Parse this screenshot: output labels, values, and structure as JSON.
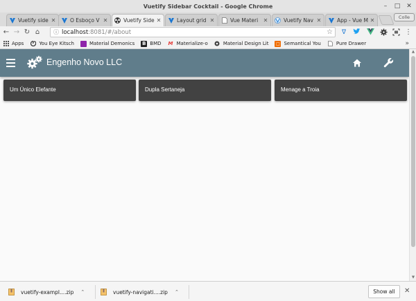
{
  "window": {
    "title": "Vuetify Sidebar Cocktail - Google Chrome"
  },
  "tabs": [
    {
      "label": "Vuetify side",
      "icon": "vuetify-icon",
      "active": false
    },
    {
      "label": "O Esboço V",
      "icon": "vuetify-icon",
      "active": false
    },
    {
      "label": "Vuetify Side",
      "icon": "radiation-icon",
      "active": true
    },
    {
      "label": "Layout grid",
      "icon": "vuetify-icon",
      "active": false
    },
    {
      "label": "Vue Materi",
      "icon": "page-icon",
      "active": false
    },
    {
      "label": "Vuetify Nav",
      "icon": "vue-icon",
      "active": false
    },
    {
      "label": "App - Vue M",
      "icon": "vuetify-icon",
      "active": false
    }
  ],
  "profile": {
    "label": "Colle"
  },
  "address_bar": {
    "host": "localhost",
    "path": ":8081/#/about"
  },
  "bookmarks": [
    {
      "label": "Apps",
      "icon": "apps-grid-icon",
      "color": "#555555"
    },
    {
      "label": "You Eye Kitsch",
      "icon": "swirl-icon",
      "color": "#333333"
    },
    {
      "label": "Material Demonics",
      "icon": "purple-square-icon",
      "color": "#8e24aa"
    },
    {
      "label": "BMD",
      "icon": "b-icon",
      "color": "#222222"
    },
    {
      "label": "Materialize-o",
      "icon": "m-icon",
      "color": "#e53935"
    },
    {
      "label": "Material Design Lit",
      "icon": "circle-icon",
      "color": "#424242"
    },
    {
      "label": "Semantical You",
      "icon": "orange-square-icon",
      "color": "#ef6c00"
    },
    {
      "label": "Pure Drawer",
      "icon": "page-icon",
      "color": "#777777"
    }
  ],
  "app": {
    "title": "Engenho Novo LLC",
    "appbar_color": "#607d8b",
    "card_color": "#424242",
    "cards": [
      {
        "label": "Um Único Elefante"
      },
      {
        "label": "Dupla Sertaneja"
      },
      {
        "label": "Menage a Troia"
      }
    ]
  },
  "downloads": [
    {
      "name": "vuetify-exampl....zip"
    },
    {
      "name": "vuetify-navigati....zip"
    }
  ],
  "shelf": {
    "show_all_label": "Show all"
  }
}
